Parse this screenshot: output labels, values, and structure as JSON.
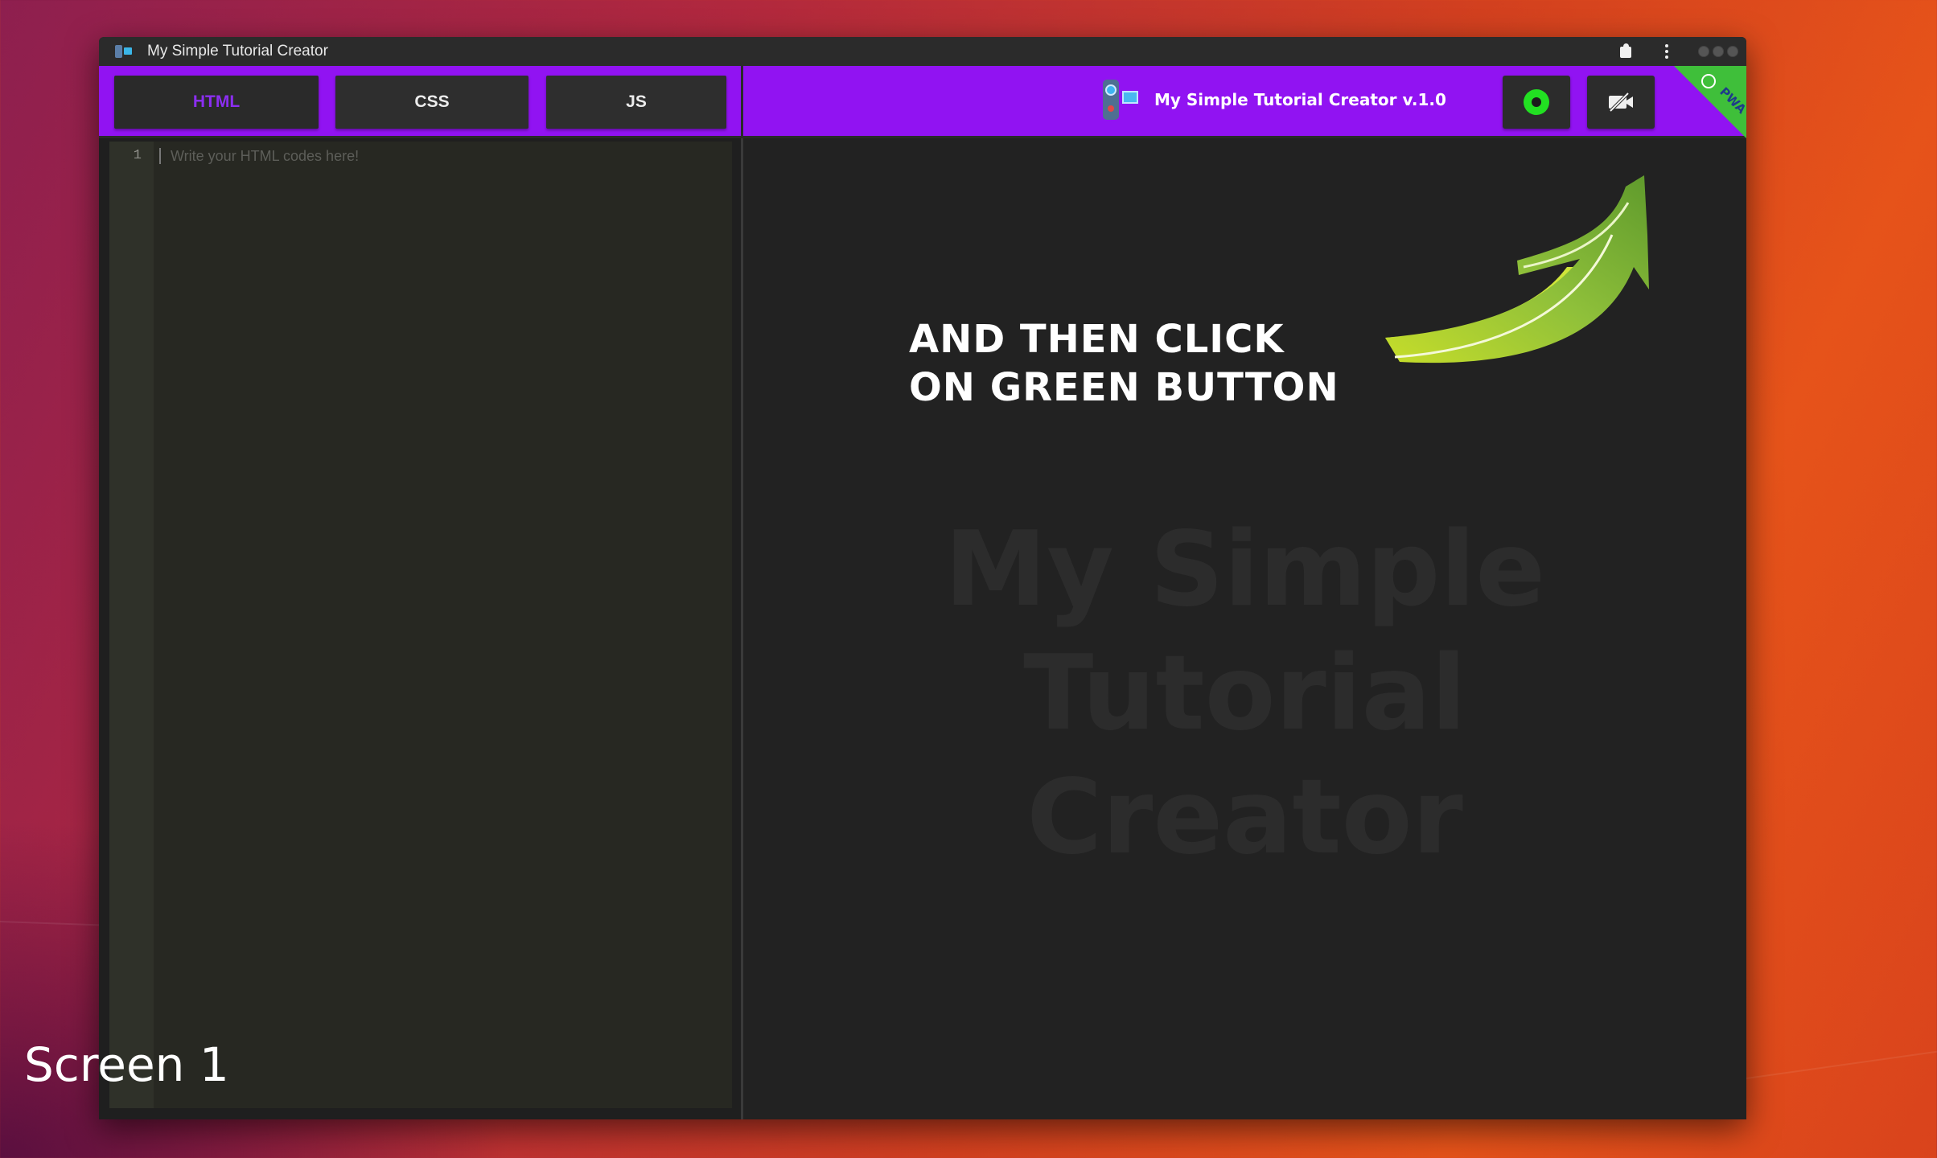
{
  "window": {
    "title": "My Simple Tutorial Creator"
  },
  "toolbar": {
    "tabs": [
      {
        "label": "HTML",
        "active": true
      },
      {
        "label": "CSS",
        "active": false
      },
      {
        "label": "JS",
        "active": false
      }
    ],
    "brand_text": "My Simple Tutorial Creator v.1.0",
    "record_button_color": "#22e022",
    "pwa_badge": "PWA",
    "accent_color": "#9113f2"
  },
  "editor": {
    "line_number": "1",
    "placeholder": "Write your HTML codes here!"
  },
  "preview": {
    "watermark_line1": "My Simple Tutorial",
    "watermark_line2": "Creator",
    "callout_line1": "AND THEN CLICK",
    "callout_line2": "ON GREEN BUTTON"
  },
  "overlay": {
    "screen_label": "Screen 1"
  },
  "icons": [
    "app-icon",
    "puzzle-icon",
    "kebab-menu-icon",
    "camera-logo-icon",
    "record-icon",
    "camera-off-icon",
    "clock-icon",
    "arrow-icon"
  ]
}
